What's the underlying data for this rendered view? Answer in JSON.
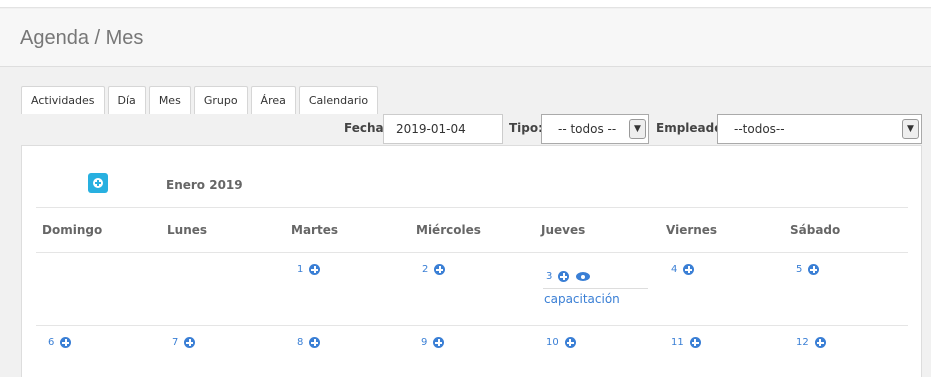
{
  "header": {
    "title": "Agenda / Mes"
  },
  "tabs": [
    {
      "label": "Actividades"
    },
    {
      "label": "Día"
    },
    {
      "label": "Mes"
    },
    {
      "label": "Grupo"
    },
    {
      "label": "Área"
    },
    {
      "label": "Calendario"
    }
  ],
  "filters": {
    "fecha_label": "Fecha:",
    "fecha_value": "2019-01-04",
    "tipo_label": "Tipo:",
    "tipo_value": "-- todos --",
    "empleado_label": "Empleado:",
    "empleado_value": "--todos--"
  },
  "calendar": {
    "month_title": "Enero 2019",
    "weekdays": [
      "Domingo",
      "Lunes",
      "Martes",
      "Miércoles",
      "Jueves",
      "Viernes",
      "Sábado"
    ],
    "week1": [
      "1",
      "2",
      "3",
      "4",
      "5"
    ],
    "week2": [
      "6",
      "7",
      "8",
      "9",
      "10",
      "11",
      "12"
    ],
    "event": {
      "label": "capacitación"
    }
  },
  "colors": {
    "accent": "#3a7fd5",
    "add_button": "#28b0e0"
  }
}
